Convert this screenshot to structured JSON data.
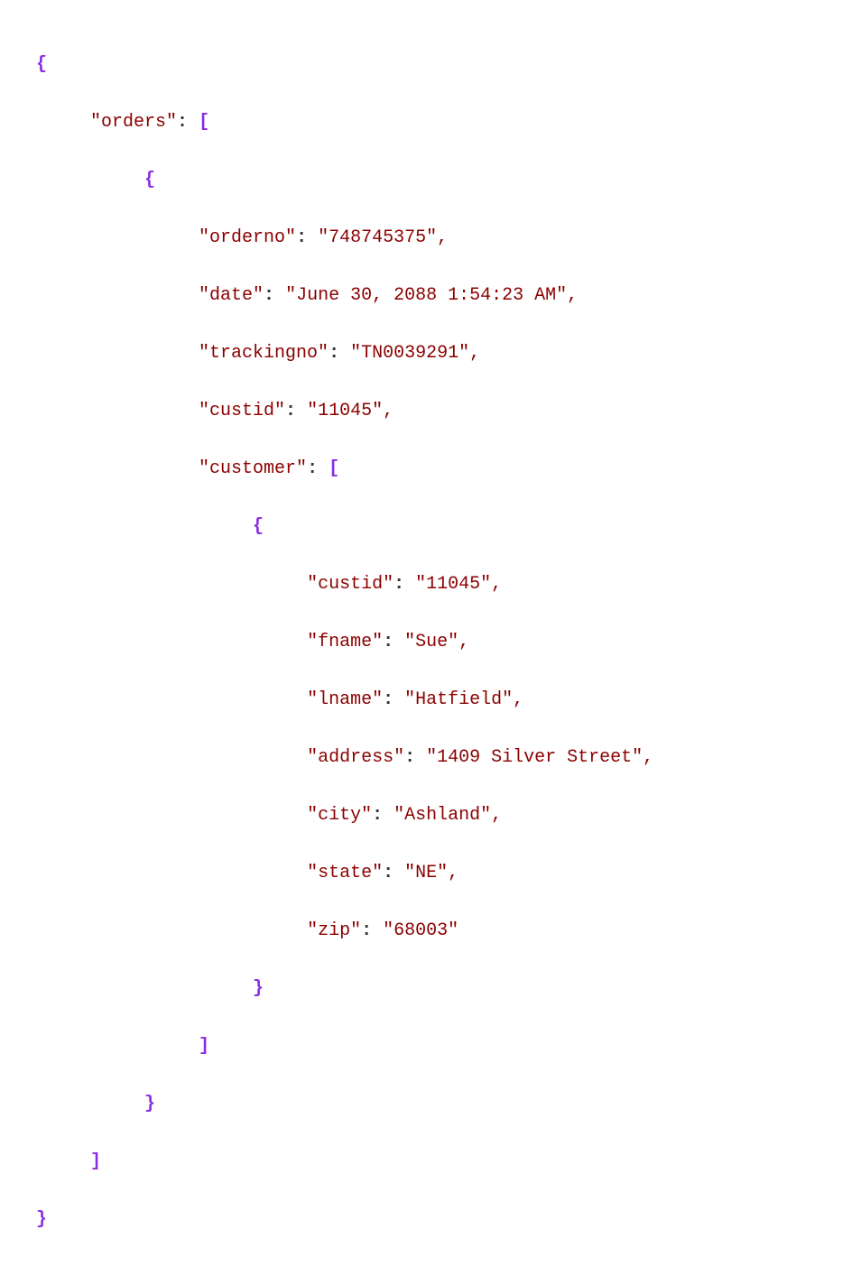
{
  "code": {
    "orders_key": "\"orders\"",
    "orderno_key": "\"orderno\"",
    "orderno_val": "\"748745375\"",
    "date_key": "\"date\"",
    "date_val": "\"June 30, 2088 1:54:23 AM\"",
    "trackingno_key": "\"trackingno\"",
    "trackingno_val": "\"TN0039291\"",
    "custid_key": "\"custid\"",
    "custid_val": "\"11045\"",
    "customer_key": "\"customer\"",
    "cust_custid_key": "\"custid\"",
    "cust_custid_val": "\"11045\"",
    "fname_key": "\"fname\"",
    "fname_val": "\"Sue\"",
    "lname_key": "\"lname\"",
    "lname_val": "\"Hatfield\"",
    "address_key": "\"address\"",
    "address_val": "\"1409 Silver Street\"",
    "city_key": "\"city\"",
    "city_val": "\"Ashland\"",
    "state_key": "\"state\"",
    "state_val": "\"NE\"",
    "zip_key": "\"zip\"",
    "zip_val": "\"68003\""
  }
}
